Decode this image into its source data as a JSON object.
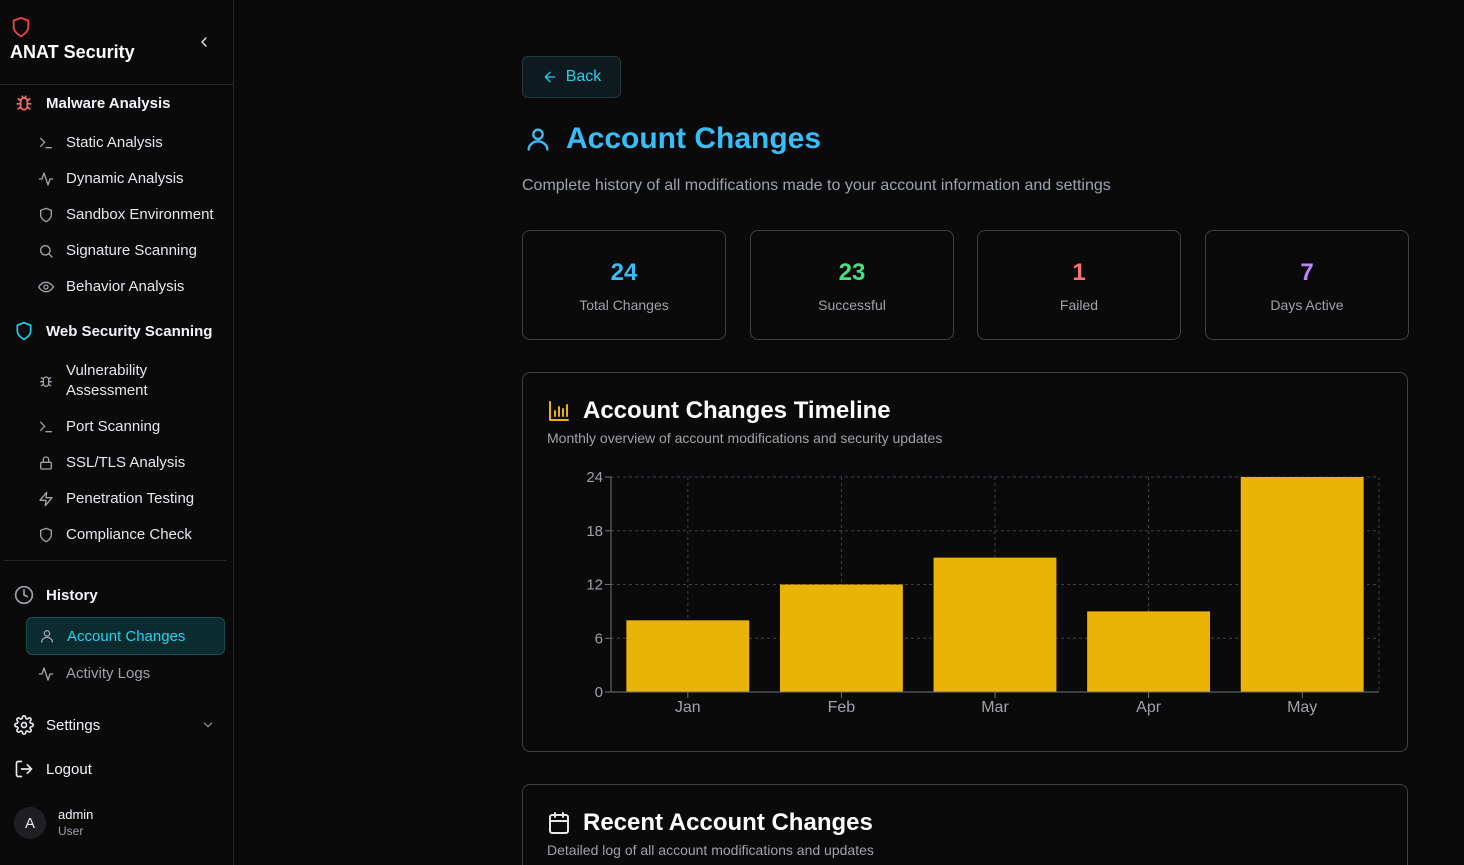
{
  "app": {
    "name": "ANAT Security"
  },
  "sidebar": {
    "malware": {
      "label": "Malware Analysis",
      "items": [
        {
          "label": "Static Analysis",
          "icon": "terminal-icon"
        },
        {
          "label": "Dynamic Analysis",
          "icon": "activity-icon"
        },
        {
          "label": "Sandbox Environment",
          "icon": "shield-icon"
        },
        {
          "label": "Signature Scanning",
          "icon": "search-icon"
        },
        {
          "label": "Behavior Analysis",
          "icon": "eye-icon"
        }
      ]
    },
    "web": {
      "label": "Web Security Scanning",
      "items": [
        {
          "label": "Vulnerability Assessment",
          "icon": "bug-icon"
        },
        {
          "label": "Port Scanning",
          "icon": "terminal-icon"
        },
        {
          "label": "SSL/TLS Analysis",
          "icon": "lock-icon"
        },
        {
          "label": "Penetration Testing",
          "icon": "zap-icon"
        },
        {
          "label": "Compliance Check",
          "icon": "shield-icon"
        }
      ]
    },
    "history": {
      "label": "History",
      "items": [
        {
          "label": "Account Changes",
          "icon": "user-icon",
          "active": true
        },
        {
          "label": "Activity Logs",
          "icon": "activity-icon"
        }
      ]
    },
    "settings_label": "Settings",
    "logout_label": "Logout",
    "user": {
      "initial": "A",
      "name": "admin",
      "role": "User"
    }
  },
  "main": {
    "back_label": "Back",
    "title": "Account Changes",
    "subtitle": "Complete history of all modifications made to your account information and settings",
    "stats": [
      {
        "value": "24",
        "label": "Total Changes",
        "color": "#38bdf8"
      },
      {
        "value": "23",
        "label": "Successful",
        "color": "#4ade80"
      },
      {
        "value": "1",
        "label": "Failed",
        "color": "#f87171"
      },
      {
        "value": "7",
        "label": "Days Active",
        "color": "#c084fc"
      }
    ],
    "timeline": {
      "title": "Account Changes Timeline",
      "subtitle": "Monthly overview of account modifications and security updates"
    },
    "recent": {
      "title": "Recent Account Changes",
      "subtitle": "Detailed log of all account modifications and updates"
    }
  },
  "colors": {
    "accent": "#22d3ee",
    "bar": "#eab308"
  },
  "chart_data": {
    "type": "bar",
    "title": "Account Changes Timeline",
    "categories": [
      "Jan",
      "Feb",
      "Mar",
      "Apr",
      "May"
    ],
    "values": [
      8,
      12,
      15,
      9,
      24
    ],
    "ylim": [
      0,
      24
    ],
    "yticks": [
      0,
      6,
      12,
      18,
      24
    ],
    "grid": true,
    "color": "#eab308"
  }
}
